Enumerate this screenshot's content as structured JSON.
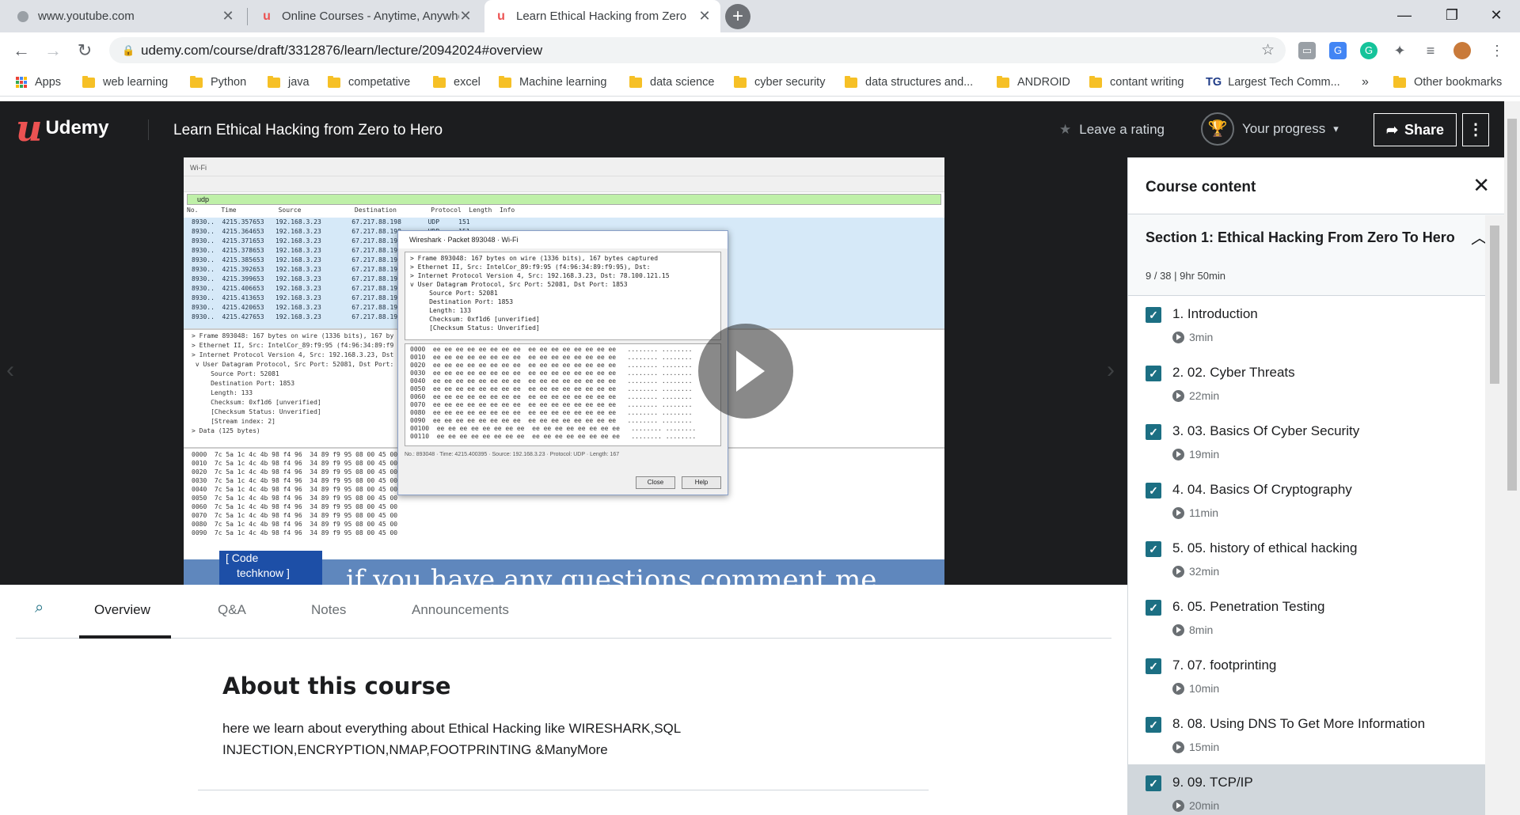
{
  "browser": {
    "tabs": [
      {
        "title": "www.youtube.com",
        "close": "✕"
      },
      {
        "title": "Online Courses - Anytime, Anywhere",
        "close": "✕"
      },
      {
        "title": "Learn Ethical Hacking from Zero",
        "close": "✕"
      }
    ],
    "new_tab": "+",
    "url": "udemy.com/course/draft/3312876/learn/lecture/20942024#overview",
    "bookmarks": [
      "Apps",
      "web learning",
      "Python",
      "java",
      "competative",
      "excel",
      "Machine learning",
      "data science",
      "cyber security",
      "data structures and...",
      "ANDROID",
      "contant writing",
      "Largest Tech Comm...",
      "Other bookmarks"
    ],
    "bookmarks_overflow": "»"
  },
  "header": {
    "brand": "Udemy",
    "course_title": "Learn Ethical Hacking from Zero to Hero",
    "rate": "Leave a rating",
    "progress": "Your progress",
    "share": "Share",
    "more": "⋮"
  },
  "video": {
    "window_title": "Wi-Fi",
    "filter": "udp",
    "dialog_title": "Wireshark · Packet 893048 · Wi-Fi",
    "close_btn": "Close",
    "help_btn": "Help",
    "subtitle": "if you have any questions comment me",
    "code_label_1": "[ Code",
    "code_label_2": "techknow ]"
  },
  "content_tabs": [
    "Overview",
    "Q&A",
    "Notes",
    "Announcements"
  ],
  "about": {
    "heading": "About this course",
    "description": "here we learn about everything about Ethical Hacking like WIRESHARK,SQL INJECTION,ENCRYPTION,NMAP,FOOTPRINTING &ManyMore"
  },
  "sidebar": {
    "title": "Course content",
    "section_title": "Section 1: Ethical Hacking From Zero To Hero",
    "section_meta": "9 / 38 | 9hr 50min",
    "lectures": [
      {
        "title": "1. Introduction",
        "duration": "3min"
      },
      {
        "title": "2. 02. Cyber Threats",
        "duration": "22min"
      },
      {
        "title": "3. 03. Basics Of Cyber Security",
        "duration": "19min"
      },
      {
        "title": "4. 04. Basics Of Cryptography",
        "duration": "11min"
      },
      {
        "title": "5. 05. history of ethical hacking",
        "duration": "32min"
      },
      {
        "title": "6. 05. Penetration Testing",
        "duration": "8min"
      },
      {
        "title": "7. 07. footprinting",
        "duration": "10min"
      },
      {
        "title": "8. 08. Using DNS To Get More Information",
        "duration": "15min"
      },
      {
        "title": "9. 09. TCP/IP",
        "duration": "20min"
      }
    ]
  },
  "colors": {
    "udemy_red": "#ec5252",
    "header_bg": "#1c1d1f",
    "checkbox": "#1c6f83"
  }
}
